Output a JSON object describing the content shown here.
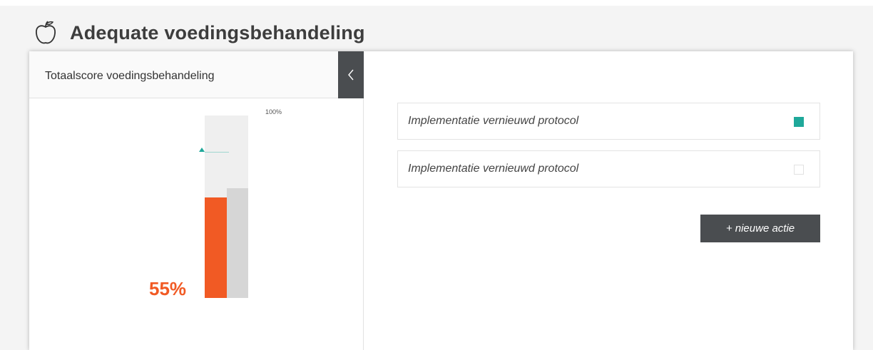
{
  "header": {
    "title": "Adequate voedingsbehandeling",
    "icon": "apple-icon"
  },
  "score_panel": {
    "title": "Totaalscore voedingsbehandeling",
    "collapse_icon": "chevron-left-icon",
    "max_label": "100%",
    "score_label": "55%",
    "score_fraction": 0.55,
    "compare_fraction": 0.6,
    "target_fraction": 0.8,
    "colors": {
      "score": "#f15a24",
      "compare": "#d6d6d6",
      "target": "#1fa89a",
      "track": "#efefef"
    }
  },
  "actions": {
    "items": [
      {
        "label": "Implementatie vernieuwd protocol",
        "checked": true
      },
      {
        "label": "Implementatie vernieuwd protocol",
        "checked": false
      }
    ],
    "new_button_label": "+ nieuwe actie"
  },
  "colors": {
    "accent": "#1fa89a",
    "dark": "#4a4d50"
  }
}
